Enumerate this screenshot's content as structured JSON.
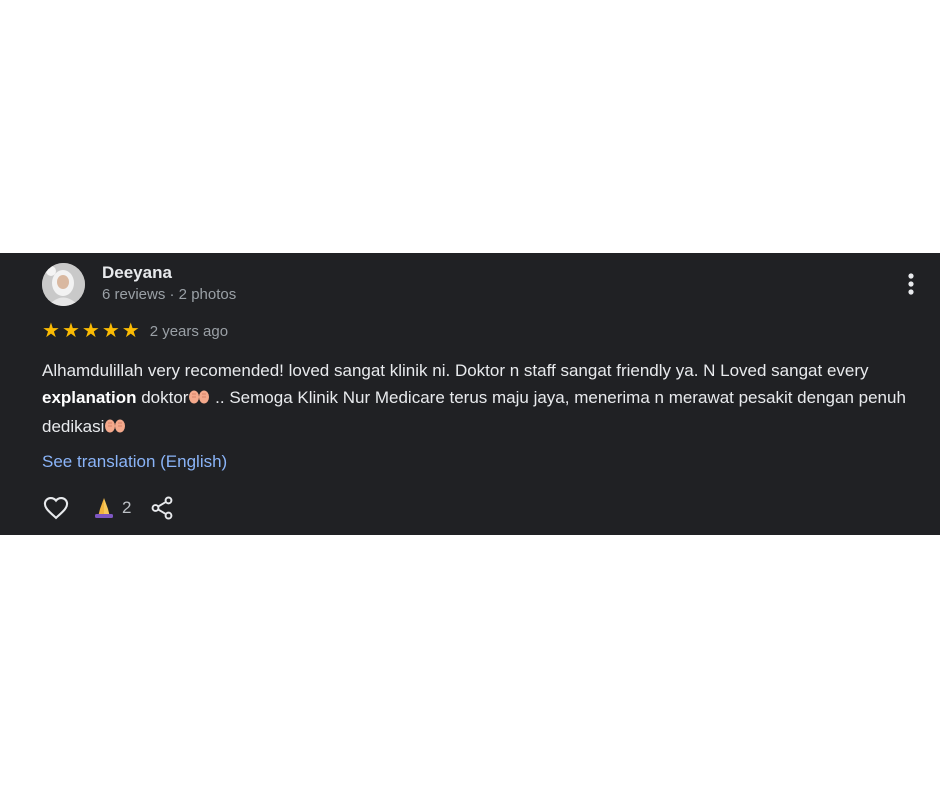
{
  "review": {
    "reviewer_name": "Deeyana",
    "reviewer_meta": "6 reviews · 2 photos",
    "rating": 5,
    "date": "2 years ago",
    "text": {
      "part1": "Alhamdulillah very recomended! loved sangat klinik ni. Doktor n staff sangat friendly ya. N Loved sangat every ",
      "bold": "explanation",
      "part2": " doktor",
      "part3": " .. Semoga Klinik Nur Medicare terus maju jaya, menerima n merawat pesakit dengan penuh dedikasi"
    },
    "translate_label": "See translation (English)",
    "reaction_count": "2",
    "icons": {
      "more": "more-vert-icon",
      "like": "heart-outline-icon",
      "reaction": "folded-hands-icon",
      "share": "share-icon",
      "inline_emoji": "open-hands-icon"
    },
    "colors": {
      "background": "#202124",
      "star": "#fbbc04",
      "link": "#8ab4f8"
    }
  }
}
